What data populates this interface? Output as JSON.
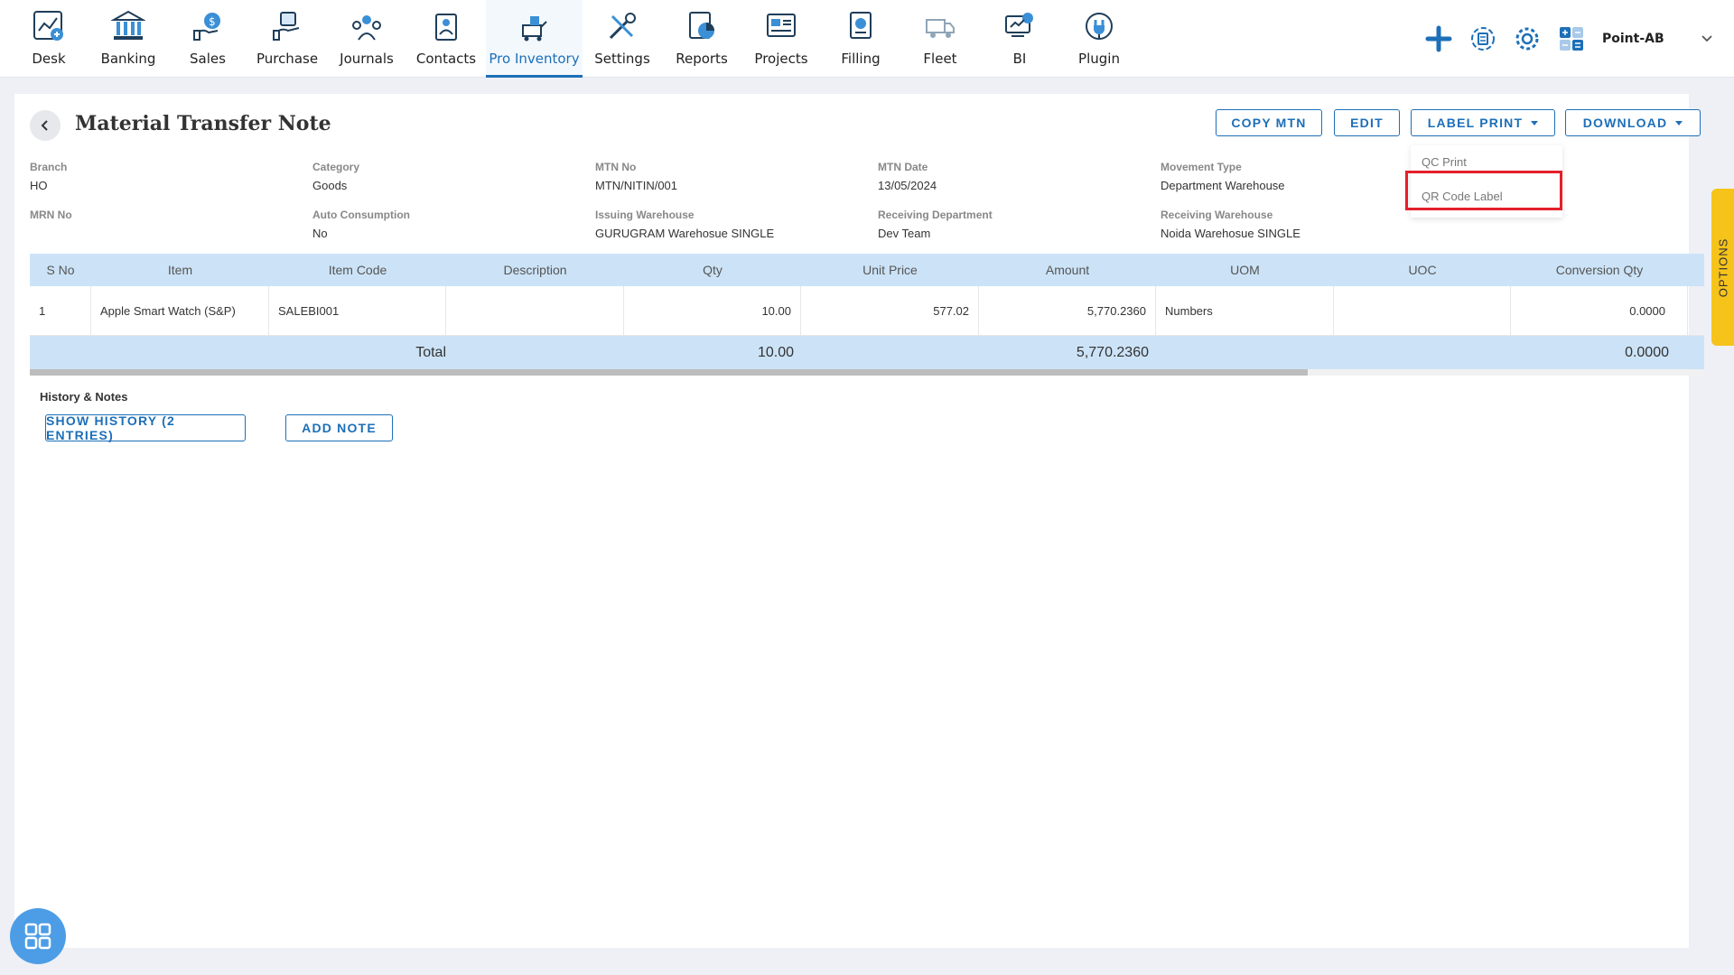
{
  "nav": [
    {
      "id": "desk",
      "label": "Desk"
    },
    {
      "id": "banking",
      "label": "Banking"
    },
    {
      "id": "sales",
      "label": "Sales"
    },
    {
      "id": "purchase",
      "label": "Purchase"
    },
    {
      "id": "journals",
      "label": "Journals"
    },
    {
      "id": "contacts",
      "label": "Contacts"
    },
    {
      "id": "pro-inventory",
      "label": "Pro Inventory"
    },
    {
      "id": "settings",
      "label": "Settings"
    },
    {
      "id": "reports",
      "label": "Reports"
    },
    {
      "id": "projects",
      "label": "Projects"
    },
    {
      "id": "filling",
      "label": "Filling"
    },
    {
      "id": "fleet",
      "label": "Fleet"
    },
    {
      "id": "bi",
      "label": "BI"
    },
    {
      "id": "plugin",
      "label": "Plugin"
    }
  ],
  "active_nav": "Pro Inventory",
  "top_right": {
    "company": "Point-AB",
    "icons": [
      "plus-icon",
      "sync-icon",
      "gear-icon",
      "calculator-icon"
    ]
  },
  "page": {
    "title": "Material Transfer Note",
    "buttons": {
      "copy": "COPY MTN",
      "edit": "EDIT",
      "label_print": "LABEL PRINT",
      "download": "DOWNLOAD"
    },
    "label_print_menu": [
      "QC Print",
      "QR Code Label"
    ]
  },
  "fields": {
    "branch": {
      "label": "Branch",
      "value": "HO"
    },
    "category": {
      "label": "Category",
      "value": "Goods"
    },
    "mtn_no": {
      "label": "MTN No",
      "value": "MTN/NITIN/001"
    },
    "mtn_date": {
      "label": "MTN Date",
      "value": "13/05/2024"
    },
    "movement_type": {
      "label": "Movement Type",
      "value": "Department Warehouse"
    },
    "mrn_no": {
      "label": "MRN No",
      "value": ""
    },
    "auto_consumption": {
      "label": "Auto Consumption",
      "value": "No"
    },
    "issuing_warehouse": {
      "label": "Issuing Warehouse",
      "value": "GURUGRAM Warehosue SINGLE"
    },
    "receiving_department": {
      "label": "Receiving Department",
      "value": "Dev Team"
    },
    "receiving_warehouse": {
      "label": "Receiving Warehouse",
      "value": "Noida Warehosue SINGLE"
    }
  },
  "table": {
    "columns": [
      "S No",
      "Item",
      "Item Code",
      "Description",
      "Qty",
      "Unit Price",
      "Amount",
      "UOM",
      "UOC",
      "Conversion Qty"
    ],
    "rows": [
      {
        "sno": "1",
        "item": "Apple Smart Watch (S&P)",
        "code": "SALEBI001",
        "description": "",
        "qty": "10.00",
        "unit_price": "577.02",
        "amount": "5,770.2360",
        "uom": "Numbers",
        "uoc": "",
        "conversion_qty": "0.0000"
      }
    ],
    "footer": {
      "label": "Total",
      "qty": "10.00",
      "amount": "5,770.2360",
      "conversion_qty": "0.0000"
    }
  },
  "history": {
    "title": "History & Notes",
    "show_history": "SHOW HISTORY (2 ENTRIES)",
    "add_note": "ADD NOTE"
  },
  "options_tab": "OPTIONS",
  "colors": {
    "accent": "#1d6fb8",
    "table_header": "#cce3f7",
    "options": "#f6c31b",
    "highlight": "#e3202b"
  }
}
